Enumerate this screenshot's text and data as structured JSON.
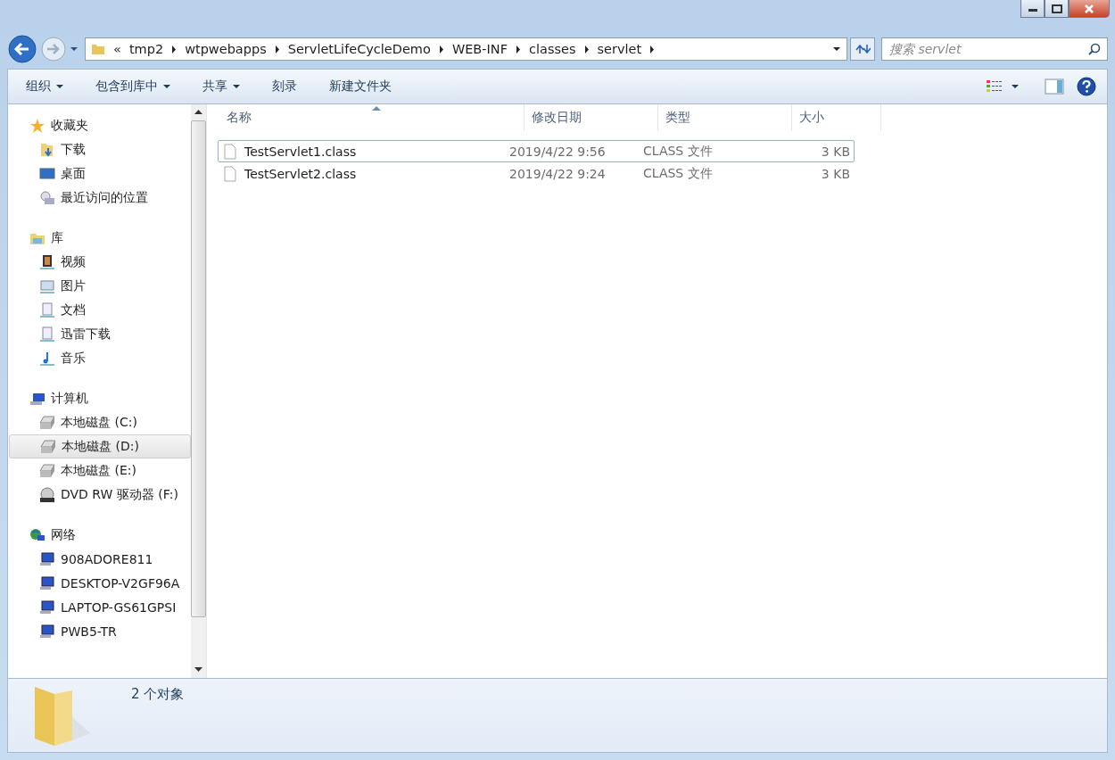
{
  "address": {
    "overflow": "«",
    "crumbs": [
      "tmp2",
      "wtpwebapps",
      "ServletLifeCycleDemo",
      "WEB-INF",
      "classes",
      "servlet"
    ]
  },
  "search": {
    "placeholder": "搜索 servlet"
  },
  "toolbar": [
    {
      "label": "组织",
      "menu": true
    },
    {
      "label": "包含到库中",
      "menu": true
    },
    {
      "label": "共享",
      "menu": true
    },
    {
      "label": "刻录",
      "menu": false
    },
    {
      "label": "新建文件夹",
      "menu": false
    }
  ],
  "sidebar": [
    {
      "label": "收藏夹",
      "items": [
        {
          "label": "下载",
          "selected": false
        },
        {
          "label": "桌面",
          "selected": false
        },
        {
          "label": "最近访问的位置",
          "selected": false
        }
      ]
    },
    {
      "label": "库",
      "items": [
        {
          "label": "视频",
          "selected": false
        },
        {
          "label": "图片",
          "selected": false
        },
        {
          "label": "文档",
          "selected": false
        },
        {
          "label": "迅雷下载",
          "selected": false
        },
        {
          "label": "音乐",
          "selected": false
        }
      ]
    },
    {
      "label": "计算机",
      "items": [
        {
          "label": "本地磁盘 (C:)",
          "selected": false
        },
        {
          "label": "本地磁盘 (D:)",
          "selected": true
        },
        {
          "label": "本地磁盘 (E:)",
          "selected": false
        },
        {
          "label": "DVD RW 驱动器 (F:)",
          "selected": false
        }
      ]
    },
    {
      "label": "网络",
      "items": [
        {
          "label": "908ADORE811",
          "selected": false
        },
        {
          "label": "DESKTOP-V2GF96A",
          "selected": false
        },
        {
          "label": "LAPTOP-GS61GPSI",
          "selected": false
        },
        {
          "label": "PWB5-TR",
          "selected": false
        }
      ]
    }
  ],
  "columns": [
    {
      "label": "名称",
      "sorted": true
    },
    {
      "label": "修改日期",
      "sorted": false
    },
    {
      "label": "类型",
      "sorted": false
    },
    {
      "label": "大小",
      "sorted": false
    }
  ],
  "rows": [
    {
      "name": "TestServlet1.class",
      "date": "2019/4/22 9:56",
      "type": "CLASS 文件",
      "size": "3 KB",
      "selected": true
    },
    {
      "name": "TestServlet2.class",
      "date": "2019/4/22 9:24",
      "type": "CLASS 文件",
      "size": "3 KB",
      "selected": false
    }
  ],
  "status": "2 个对象"
}
